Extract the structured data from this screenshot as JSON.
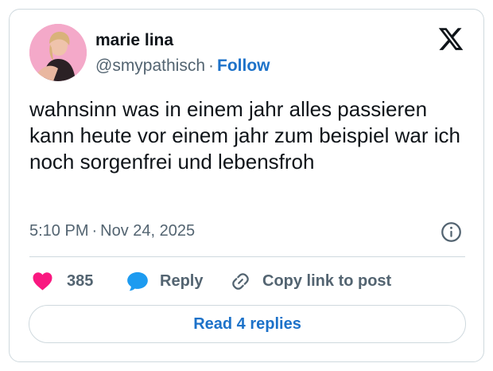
{
  "tweet": {
    "author": {
      "display_name": "marie lina",
      "handle": "@smypathisch",
      "separator": "·",
      "follow_label": "Follow"
    },
    "text": "wahnsinn was in einem jahr alles passieren kann heute vor einem jahr zum beispiel war ich noch sorgenfrei und lebensfroh",
    "time": "5:10 PM",
    "date": "Nov 24, 2025",
    "actions": {
      "likes_count": "385",
      "reply_label": "Reply",
      "copy_link_label": "Copy link to post"
    },
    "read_replies_label": "Read 4 replies"
  },
  "icons": {
    "logo": "x-logo-icon",
    "info": "info-icon",
    "like": "heart-icon",
    "reply": "speech-bubble-icon",
    "copy": "link-icon"
  },
  "colors": {
    "like": "#f91880",
    "reply_icon": "#1d9bf0",
    "link": "#1d72c9",
    "secondary_text": "#536471",
    "border": "#cfd9de"
  }
}
